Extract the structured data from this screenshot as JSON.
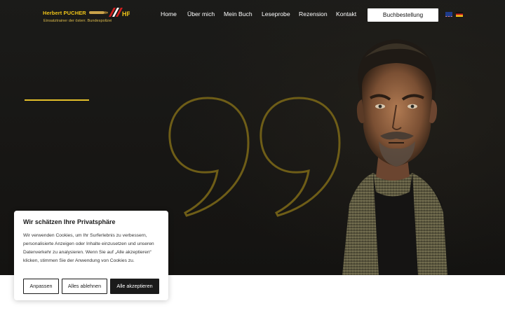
{
  "logo": {
    "name": "Herbert PUCHER",
    "initials": "HP",
    "tagline": "Einsatztrainer der österr. Bundespolizei"
  },
  "nav": {
    "items": [
      {
        "label": "Home"
      },
      {
        "label": "Über mich"
      },
      {
        "label": "Mein Buch"
      },
      {
        "label": "Leseprobe"
      },
      {
        "label": "Rezension"
      },
      {
        "label": "Kontakt"
      }
    ],
    "order_button": "Buchbestellung",
    "languages": [
      "English",
      "Deutsch"
    ]
  },
  "cookie": {
    "title": "Wir schätzen Ihre Privatsphäre",
    "text": "Wir verwenden Cookies, um Ihr Surferlebnis zu verbessern, personalisierte Anzeigen oder Inhalte einzusetzen und unseren Datenverkehr zu analysieren. Wenn Sie auf „Alle akzeptieren“ klicken, stimmen Sie der Anwendung von Cookies zu.",
    "customize": "Anpassen",
    "reject": "Alles ablehnen",
    "accept": "Alle akzeptieren"
  },
  "colors": {
    "accent": "#e3bf2a",
    "hero_background": "#171614",
    "button_dark": "#1b1b1b"
  }
}
